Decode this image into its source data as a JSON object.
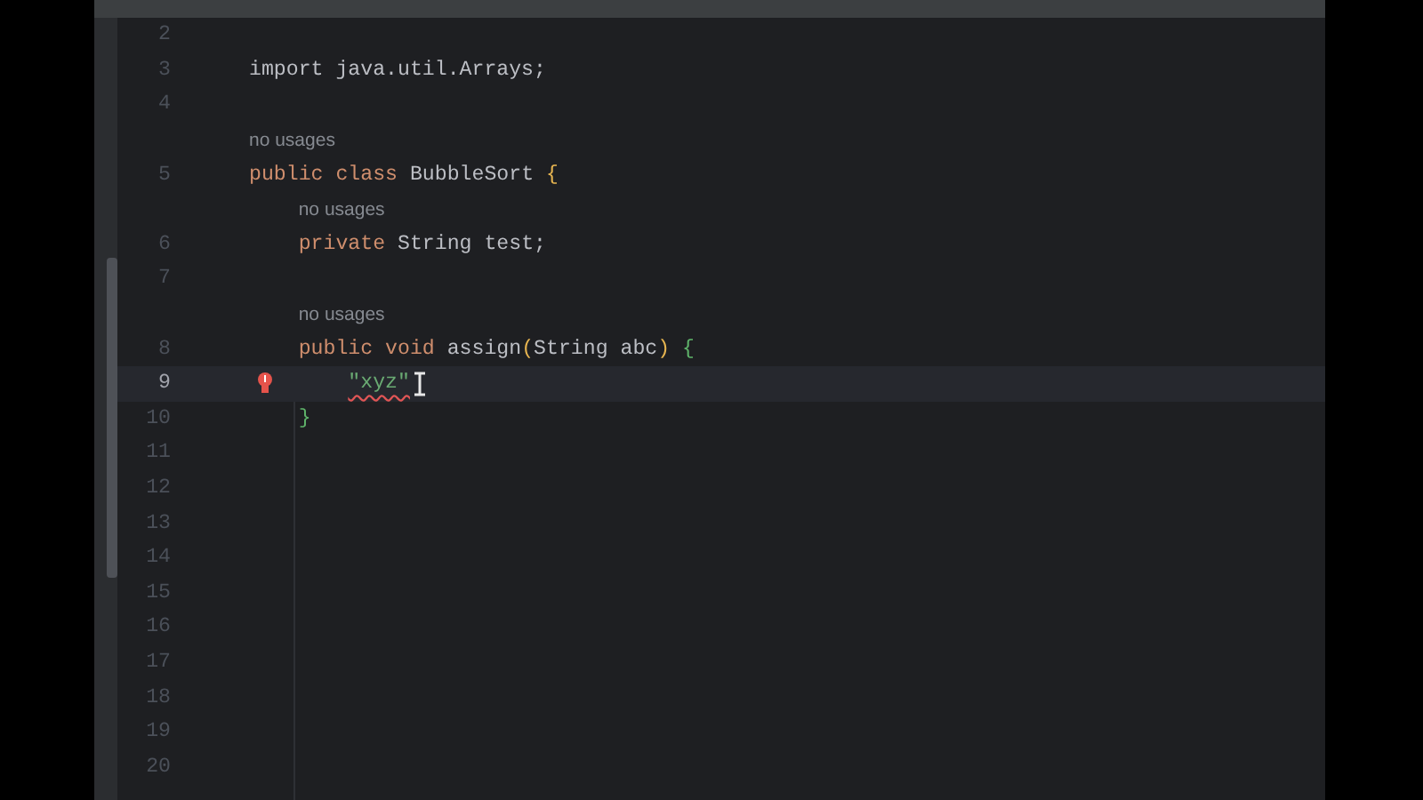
{
  "editor": {
    "rows": [
      {
        "kind": "code",
        "number": "2",
        "current": false,
        "tokens": []
      },
      {
        "kind": "code",
        "number": "3",
        "current": false,
        "tokens": [
          {
            "text": "import java.util.Arrays;",
            "kind": "plain",
            "error": false
          }
        ]
      },
      {
        "kind": "code",
        "number": "4",
        "current": false,
        "tokens": []
      },
      {
        "kind": "hint",
        "text": "no usages"
      },
      {
        "kind": "code",
        "number": "5",
        "current": false,
        "tokens": [
          {
            "text": "public class",
            "kind": "keyword",
            "error": false
          },
          {
            "text": " BubbleSort ",
            "kind": "plain",
            "error": false
          },
          {
            "text": "{",
            "kind": "brace",
            "error": false
          }
        ]
      },
      {
        "kind": "hint",
        "text": "    no usages"
      },
      {
        "kind": "code",
        "number": "6",
        "current": false,
        "tokens": [
          {
            "text": "    private",
            "kind": "keyword",
            "error": false
          },
          {
            "text": " String test;",
            "kind": "plain",
            "error": false
          }
        ]
      },
      {
        "kind": "code",
        "number": "7",
        "current": false,
        "tokens": []
      },
      {
        "kind": "hint",
        "text": "    no usages"
      },
      {
        "kind": "code",
        "number": "8",
        "current": false,
        "tokens": [
          {
            "text": "    public void",
            "kind": "keyword",
            "error": false
          },
          {
            "text": " assign",
            "kind": "plain",
            "error": false
          },
          {
            "text": "(",
            "kind": "brace",
            "error": false
          },
          {
            "text": "String abc",
            "kind": "plain",
            "error": false
          },
          {
            "text": ") ",
            "kind": "brace",
            "error": false
          },
          {
            "text": "{",
            "kind": "match",
            "error": false
          }
        ]
      },
      {
        "kind": "code",
        "number": "9",
        "current": true,
        "error_bulb": true,
        "tokens": [
          {
            "text": "        \"xyz\"",
            "kind": "string",
            "error": true
          }
        ]
      },
      {
        "kind": "code",
        "number": "10",
        "current": false,
        "tokens": [
          {
            "text": "    }",
            "kind": "match",
            "error": false
          }
        ]
      },
      {
        "kind": "code",
        "number": "11",
        "current": false,
        "tokens": []
      },
      {
        "kind": "code",
        "number": "12",
        "current": false,
        "tokens": []
      },
      {
        "kind": "code",
        "number": "13",
        "current": false,
        "tokens": []
      },
      {
        "kind": "code",
        "number": "14",
        "current": false,
        "tokens": []
      },
      {
        "kind": "code",
        "number": "15",
        "current": false,
        "tokens": []
      },
      {
        "kind": "code",
        "number": "16",
        "current": false,
        "tokens": []
      },
      {
        "kind": "code",
        "number": "17",
        "current": false,
        "tokens": []
      },
      {
        "kind": "code",
        "number": "18",
        "current": false,
        "tokens": []
      },
      {
        "kind": "code",
        "number": "19",
        "current": false,
        "tokens": []
      },
      {
        "kind": "code",
        "number": "20",
        "current": false,
        "tokens": []
      }
    ]
  }
}
